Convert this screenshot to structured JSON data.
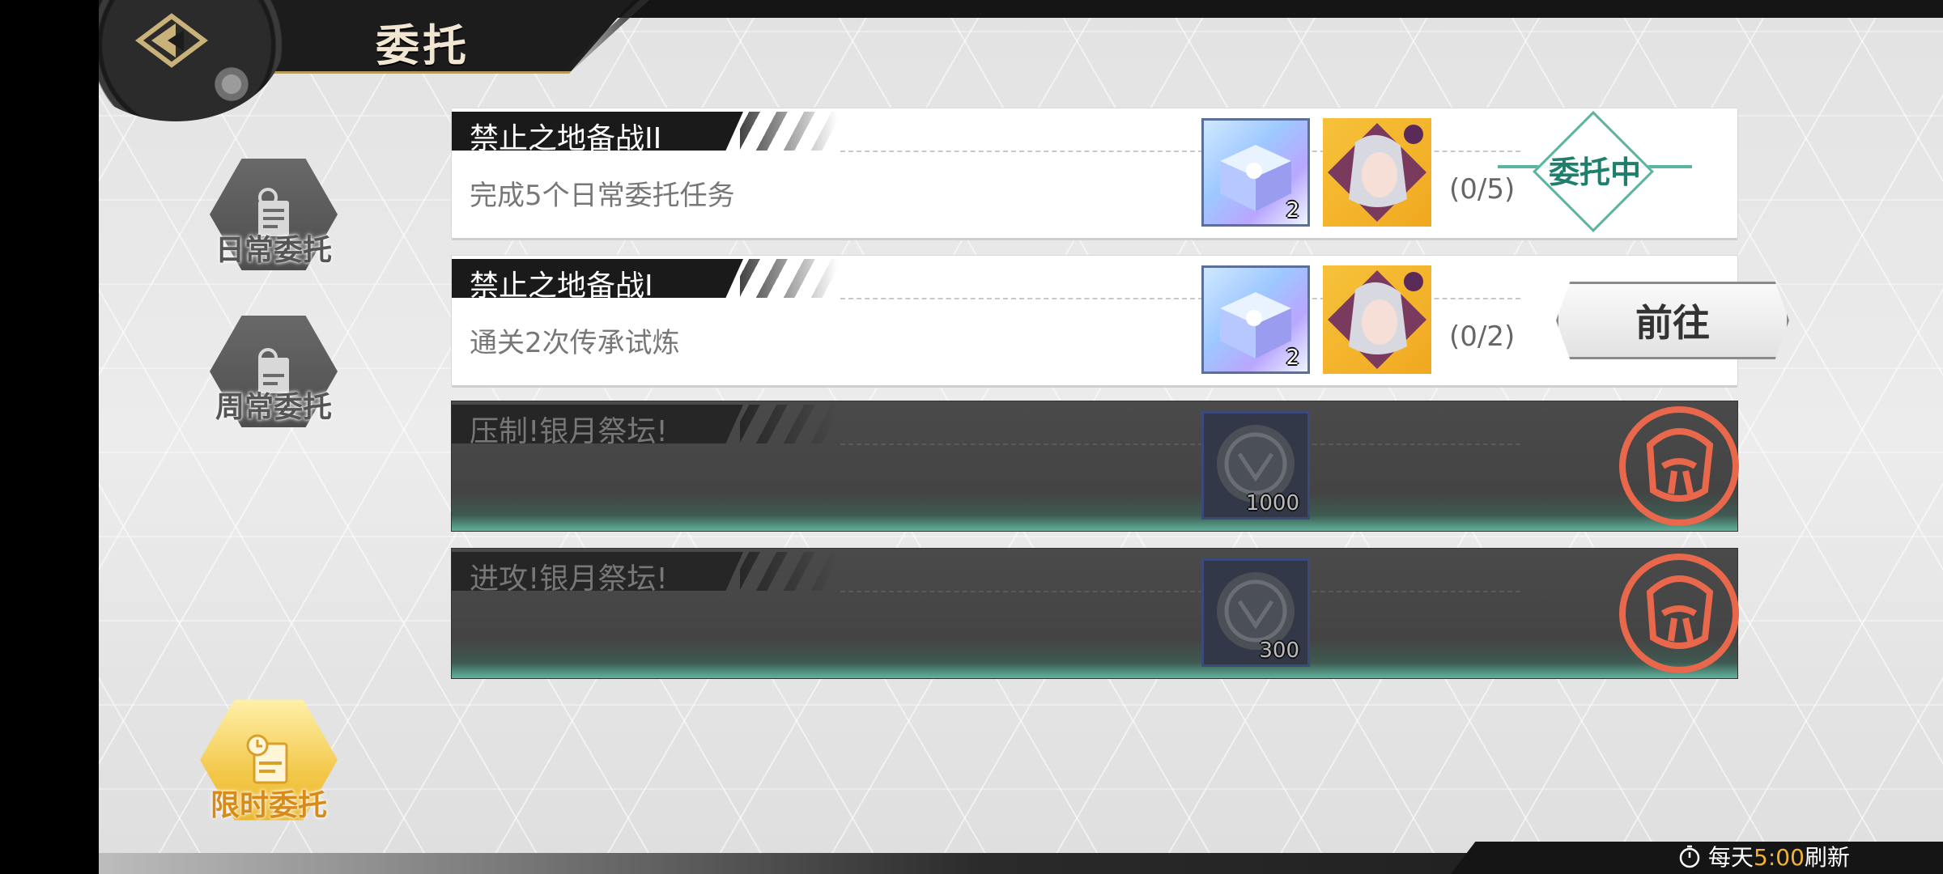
{
  "header": {
    "title": "委托"
  },
  "sidebar": {
    "items": [
      {
        "label": "日常委托",
        "active": false,
        "icon": "daily-document-gear-icon"
      },
      {
        "label": "周常委托",
        "active": false,
        "icon": "weekly-document-search-icon"
      },
      {
        "label": "限时委托",
        "active": true,
        "icon": "limited-document-clock-icon"
      }
    ]
  },
  "missions": [
    {
      "name": "禁止之地备战II",
      "description": "完成5个日常委托任务",
      "progress": "(0/5)",
      "state": "in-progress",
      "status_label": "委托中",
      "rewards": [
        {
          "icon": "crystal-box-icon",
          "count": "2"
        },
        {
          "icon": "hero-portrait-icon",
          "count": ""
        }
      ]
    },
    {
      "name": "禁止之地备战I",
      "description": "通关2次传承试炼",
      "progress": "(0/2)",
      "state": "available",
      "button_label": "前往",
      "rewards": [
        {
          "icon": "crystal-box-icon",
          "count": "2"
        },
        {
          "icon": "hero-portrait-icon",
          "count": ""
        }
      ]
    },
    {
      "name": "压制!银月祭坛!",
      "description": "",
      "progress": "",
      "state": "locked",
      "rewards": [
        {
          "icon": "silver-moon-coin-icon",
          "count": "1000"
        }
      ]
    },
    {
      "name": "进攻!银月祭坛!",
      "description": "",
      "progress": "",
      "state": "locked",
      "rewards": [
        {
          "icon": "silver-moon-coin-icon",
          "count": "300"
        }
      ]
    }
  ],
  "footer": {
    "refresh_prefix": "每天",
    "refresh_time": "5:00",
    "refresh_suffix": "刷新"
  },
  "colors": {
    "accent_gold": "#f2b233",
    "teal_status": "#1f7e6c",
    "locked_red": "#e9684b",
    "header_dark": "#1c1c1c"
  }
}
